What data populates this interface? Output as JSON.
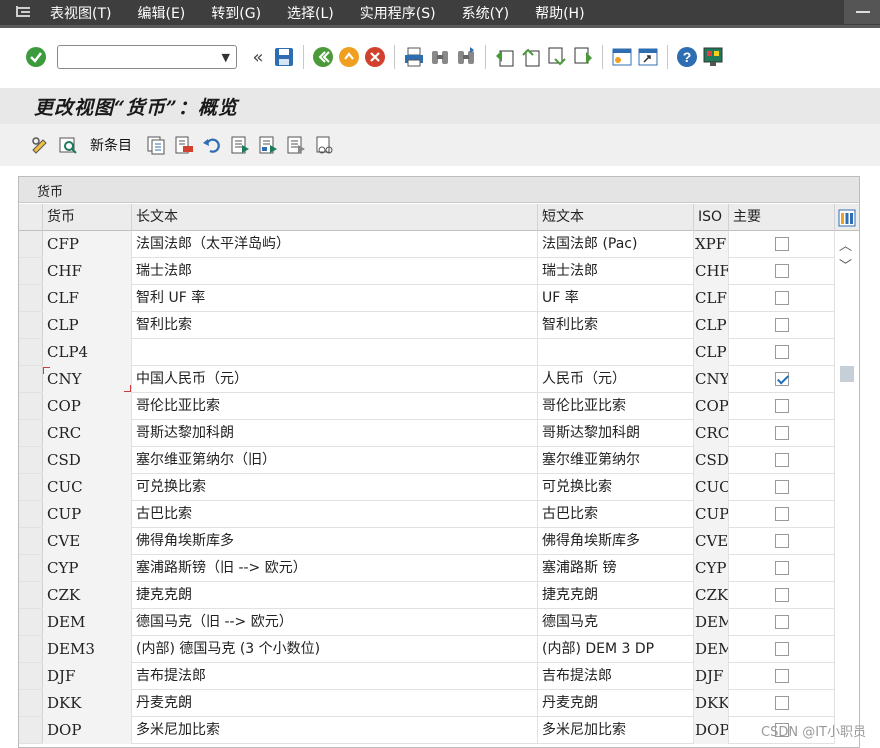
{
  "menu": {
    "items": [
      "表视图(T)",
      "编辑(E)",
      "转到(G)",
      "选择(L)",
      "实用程序(S)",
      "系统(Y)",
      "帮助(H)"
    ]
  },
  "toolbar": {
    "command_value": "",
    "icons": [
      "check-icon",
      "back-double-chevron-icon",
      "save-icon",
      "back-icon",
      "exit-icon",
      "cancel-icon",
      "print-icon",
      "find-icon",
      "find-next-icon",
      "first-page-icon",
      "prev-page-icon",
      "next-page-icon",
      "last-page-icon",
      "create-session-icon",
      "shortcut-icon",
      "help-icon",
      "layout-icon"
    ]
  },
  "title": "更改视图“货币”：概览",
  "app_toolbar": {
    "new_entries_label": "新条目"
  },
  "table": {
    "title": "货币",
    "headers": {
      "currency": "货币",
      "long_text": "长文本",
      "short_text": "短文本",
      "iso": "ISO",
      "main": "主要"
    },
    "rows": [
      {
        "currency": "CFP",
        "long_text": "法国法郎（太平洋岛屿）",
        "short_text": "法国法郎 (Pac)",
        "iso": "XPF",
        "main": false
      },
      {
        "currency": "CHF",
        "long_text": "瑞士法郎",
        "short_text": "瑞士法郎",
        "iso": "CHF",
        "main": false
      },
      {
        "currency": "CLF",
        "long_text": "智利 UF 率",
        "short_text": "UF 率",
        "iso": "CLF",
        "main": false
      },
      {
        "currency": "CLP",
        "long_text": "智利比索",
        "short_text": "智利比索",
        "iso": "CLP",
        "main": false
      },
      {
        "currency": "CLP4",
        "long_text": "",
        "short_text": "",
        "iso": "CLP",
        "main": false
      },
      {
        "currency": "CNY",
        "long_text": "中国人民币（元）",
        "short_text": "人民币（元）",
        "iso": "CNY",
        "main": true
      },
      {
        "currency": "COP",
        "long_text": "哥伦比亚比索",
        "short_text": "哥伦比亚比索",
        "iso": "COP",
        "main": false
      },
      {
        "currency": "CRC",
        "long_text": "哥斯达黎加科朗",
        "short_text": "哥斯达黎加科朗",
        "iso": "CRC",
        "main": false
      },
      {
        "currency": "CSD",
        "long_text": "塞尔维亚第纳尔（旧）",
        "short_text": "塞尔维亚第纳尔",
        "iso": "CSD",
        "main": false
      },
      {
        "currency": "CUC",
        "long_text": "可兑换比索",
        "short_text": "可兑换比索",
        "iso": "CUC",
        "main": false
      },
      {
        "currency": "CUP",
        "long_text": "古巴比索",
        "short_text": "古巴比索",
        "iso": "CUP",
        "main": false
      },
      {
        "currency": "CVE",
        "long_text": "佛得角埃斯库多",
        "short_text": "佛得角埃斯库多",
        "iso": "CVE",
        "main": false
      },
      {
        "currency": "CYP",
        "long_text": "塞浦路斯镑（旧 --> 欧元）",
        "short_text": "塞浦路斯 镑",
        "iso": "CYP",
        "main": false
      },
      {
        "currency": "CZK",
        "long_text": "捷克克朗",
        "short_text": "捷克克朗",
        "iso": "CZK",
        "main": false
      },
      {
        "currency": "DEM",
        "long_text": "德国马克（旧 --> 欧元）",
        "short_text": "德国马克",
        "iso": "DEM",
        "main": false
      },
      {
        "currency": "DEM3",
        "long_text": "(内部) 德国马克 (3 个小数位)",
        "short_text": "(内部) DEM 3 DP",
        "iso": "DEM",
        "main": false
      },
      {
        "currency": "DJF",
        "long_text": "吉布提法郎",
        "short_text": "吉布提法郎",
        "iso": "DJF",
        "main": false
      },
      {
        "currency": "DKK",
        "long_text": "丹麦克朗",
        "short_text": "丹麦克朗",
        "iso": "DKK",
        "main": false
      },
      {
        "currency": "DOP",
        "long_text": "多米尼加比索",
        "short_text": "多米尼加比索",
        "iso": "DOP",
        "main": false
      }
    ]
  },
  "watermark": "CSDN @IT小职员"
}
